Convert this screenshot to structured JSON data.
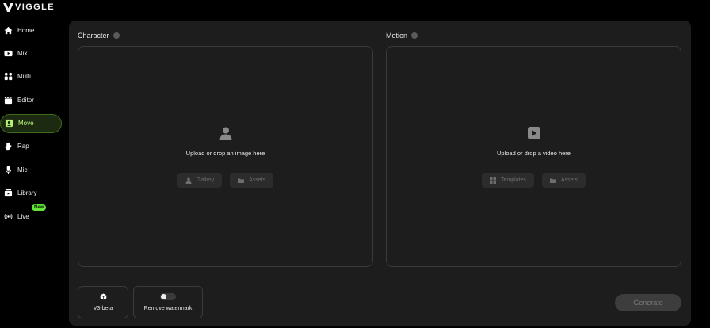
{
  "brand": {
    "name": "VIGGLE"
  },
  "sidebar": {
    "items": [
      {
        "label": "Home",
        "icon": "home-icon"
      },
      {
        "label": "Mix",
        "icon": "play-box-icon"
      },
      {
        "label": "Multi",
        "icon": "people-icon"
      },
      {
        "label": "Editor",
        "icon": "clapperboard-icon"
      },
      {
        "label": "Move",
        "icon": "person-box-icon",
        "active": true
      },
      {
        "label": "Rap",
        "icon": "hand-wave-icon"
      },
      {
        "label": "Mic",
        "icon": "mic-icon"
      },
      {
        "label": "Library",
        "icon": "library-icon"
      },
      {
        "label": "Live",
        "icon": "broadcast-icon",
        "badge": "New"
      }
    ]
  },
  "character": {
    "title": "Character",
    "prompt": "Upload or drop an image here",
    "buttons": {
      "gallery": "Gallery",
      "assets": "Assets"
    }
  },
  "motion": {
    "title": "Motion",
    "prompt": "Upload or drop a video here",
    "buttons": {
      "templates": "Templates",
      "assets": "Assets"
    }
  },
  "options": {
    "model": "V3-beta",
    "watermark": "Remove watermark",
    "watermark_enabled": false
  },
  "actions": {
    "generate": "Generate"
  },
  "colors": {
    "accent": "#63e63a",
    "active_bg": "#1b2a10",
    "panel": "#1d1d1d"
  }
}
